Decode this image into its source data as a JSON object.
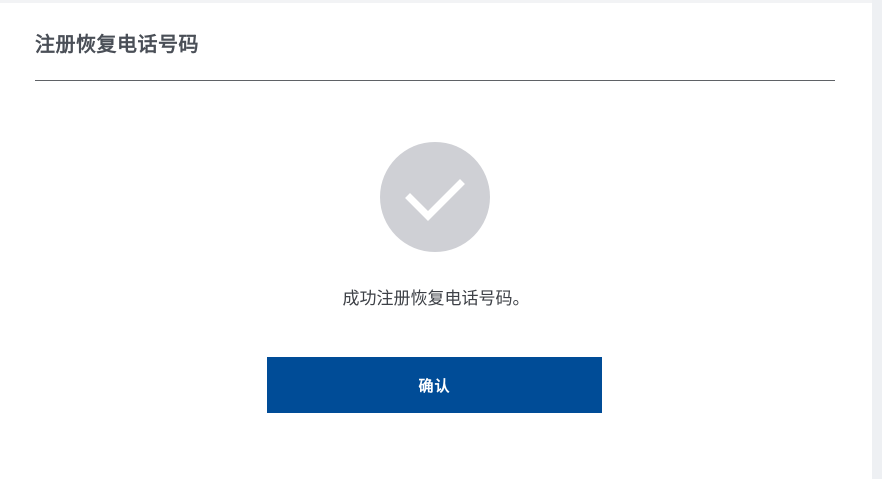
{
  "dialog": {
    "title": "注册恢复电话号码",
    "success_icon": "check-icon",
    "message": "成功注册恢复电话号码。",
    "confirm_label": "确认"
  },
  "colors": {
    "confirm_button": "#004c97",
    "icon_circle": "#cfd0d5",
    "check_mark": "#ffffff",
    "title_text": "#4a4f57",
    "body_text": "#3e4147"
  }
}
